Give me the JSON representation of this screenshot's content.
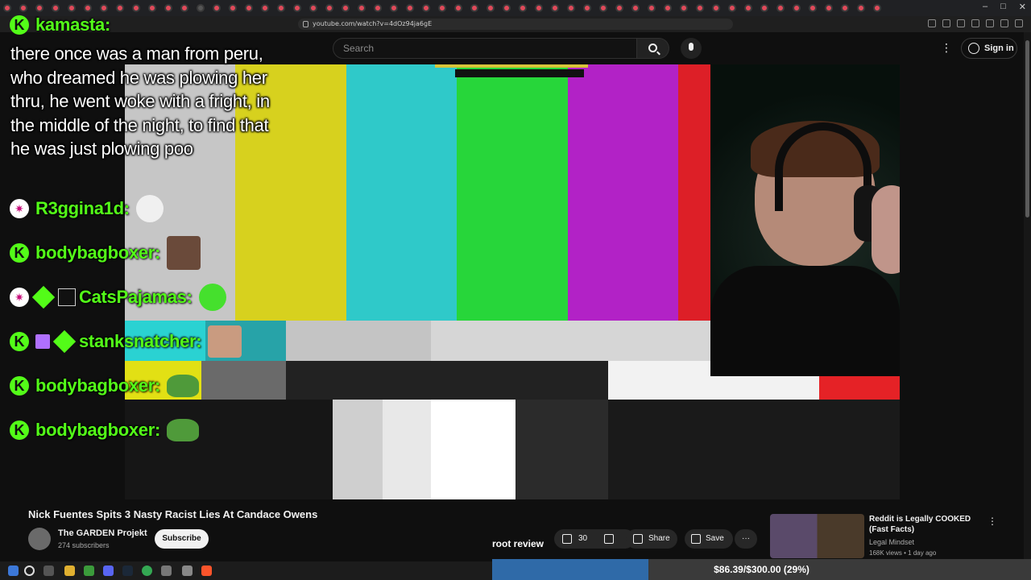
{
  "browser": {
    "url": "youtube.com/watch?v=4dOz94ja6gE",
    "window_controls": [
      "–",
      "□",
      "✕"
    ]
  },
  "youtube": {
    "search_placeholder": "Search",
    "sign_in": "Sign in",
    "video_title": "Nick Fuentes Spits 3 Nasty Racist Lies At Candace Owens",
    "channel_name": "The GARDEN Projekt",
    "subscribers": "274 subscribers",
    "subscribe_label": "Subscribe",
    "like_count": "30",
    "share_label": "Share",
    "save_label": "Save",
    "more_label": "···",
    "recommended": {
      "title": "Reddit is Legally COOKED (Fast Facts)",
      "channel": "Legal Mindset",
      "meta": "168K views • 1 day ago"
    }
  },
  "chat": {
    "first_user": "kamasta:",
    "first_message": "there once was a man from peru, who dreamed he was plowing her thru, he went woke with a fright, in the middle of the night, to find that he was just plowing poo",
    "rows": [
      {
        "user": "R3ggina1d:"
      },
      {
        "user": "bodybagboxer:"
      },
      {
        "user": "CatsPajamas:"
      },
      {
        "user": "stanksnatcher:"
      },
      {
        "user": "bodybagboxer:"
      },
      {
        "user": "bodybagboxer:"
      }
    ],
    "colors": {
      "username": "#53fc18"
    }
  },
  "overlay": {
    "root_review": "root review",
    "goal_text": "$86.39/$300.00 (29%)",
    "goal_progress": 0.29
  },
  "video": {
    "bar_colors": [
      "#c6c6c6",
      "#d7d11e",
      "#2fc9c9",
      "#27d63a",
      "#b222c6",
      "#dd1f27",
      "#3a3ad0"
    ]
  }
}
